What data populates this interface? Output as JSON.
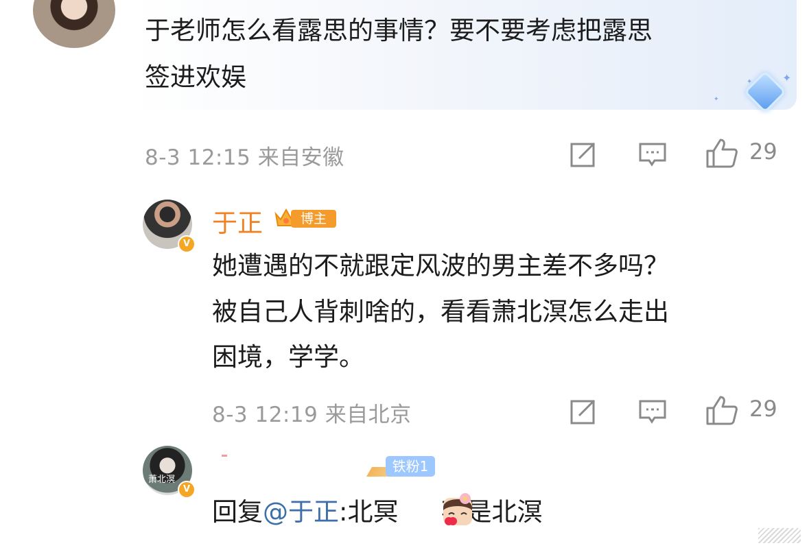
{
  "comments": [
    {
      "text_line1": "于老师怎么看露思的事情？要不要考虑把露思",
      "text_line2": "签进欢娱",
      "date": "8-3 12:15",
      "location": "来自安徽",
      "likes": "29"
    },
    {
      "username": "于正",
      "badge": "博主",
      "text_line1": "她遭遇的不就跟定风波的男主差不多吗？",
      "text_line2": "被自己人背刺啥的，看看萧北溟怎么走出",
      "text_line3": "困境，学学。",
      "date": "8-3 12:19",
      "location": "来自北京",
      "likes": "29"
    },
    {
      "fan_badge": "铁粉1",
      "reply_prefix": "回复",
      "reply_at": "@于正",
      "reply_colon": ":北冥",
      "reply_rest": "不是北溟",
      "avatar_text": "萧北溟"
    }
  ],
  "icons": {
    "edit": "edit-icon",
    "comment": "comment-icon",
    "like": "thumbs-up-icon",
    "verified": "verified-v-icon",
    "crown": "crown-icon"
  },
  "colors": {
    "name": "#f08224",
    "meta": "#9a9a9a",
    "link": "#3e6fa8",
    "badge_orange": "#f59b2c",
    "badge_blue": "#9cc7ff"
  }
}
